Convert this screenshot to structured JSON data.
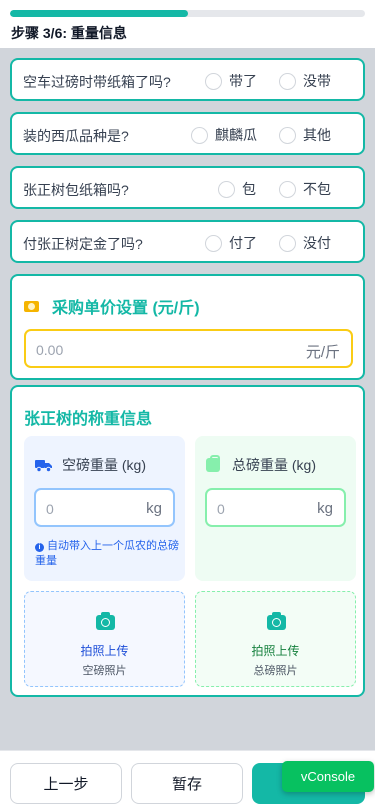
{
  "header": {
    "step_title": "步骤 3/6: 重量信息",
    "progress_percent": 50,
    "accent_color": "#14b8a6"
  },
  "questions": [
    {
      "text": "空车过磅时带纸箱了吗?",
      "options": [
        "带了",
        "没带"
      ]
    },
    {
      "text": "装的西瓜品种是?",
      "options": [
        "麒麟瓜",
        "其他"
      ]
    },
    {
      "text": "张正树包纸箱吗?",
      "options": [
        "包",
        "不包"
      ]
    },
    {
      "text": "付张正树定金了吗?",
      "options": [
        "付了",
        "没付"
      ]
    }
  ],
  "price": {
    "title": "采购单价设置 (元/斤)",
    "icon": "cash-icon",
    "placeholder": "0.00",
    "unit": "元/斤"
  },
  "weighing": {
    "title": "张正树的称重信息",
    "empty": {
      "label": "空磅重量 (kg)",
      "icon": "truck-icon",
      "placeholder": "0",
      "unit": "kg",
      "hint": "自动带入上一个瓜农的总磅重量",
      "upload_label": "拍照上传",
      "upload_sub": "空磅照片"
    },
    "total": {
      "label": "总磅重量 (kg)",
      "icon": "weight-bag-icon",
      "placeholder": "0",
      "unit": "kg",
      "upload_label": "拍照上传",
      "upload_sub": "总磅照片"
    }
  },
  "footer": {
    "prev_label": "上一步",
    "save_label": "暂存"
  },
  "vconsole_label": "vConsole"
}
